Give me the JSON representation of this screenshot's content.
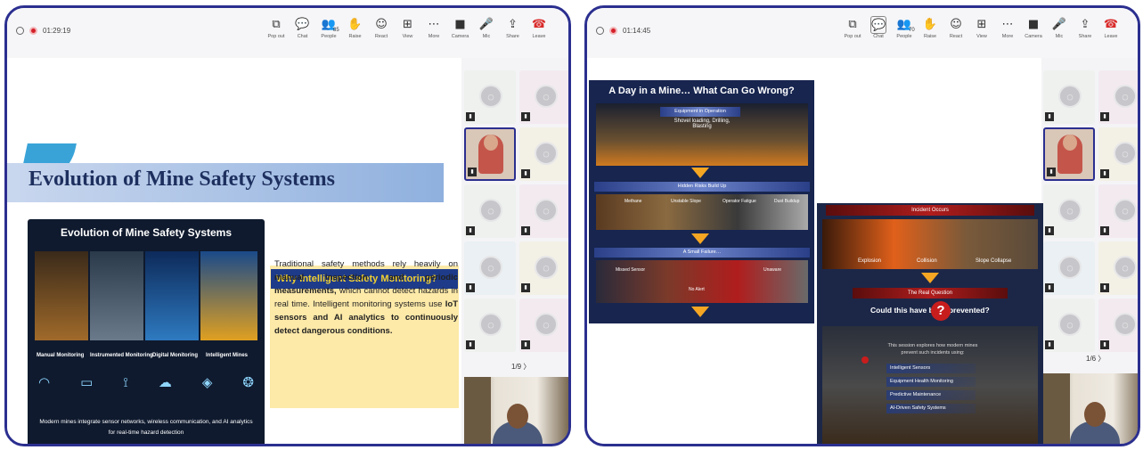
{
  "left": {
    "timer": "01:29:19",
    "toolbar": [
      {
        "icon": "popout-icon",
        "glyph": "⧉",
        "label": "Pop out"
      },
      {
        "icon": "chat-icon",
        "glyph": "💬",
        "label": "Chat"
      },
      {
        "icon": "people-icon",
        "glyph": "👥",
        "label": "People",
        "count": "85"
      },
      {
        "icon": "raise-hand-icon",
        "glyph": "✋",
        "label": "Raise"
      },
      {
        "icon": "react-icon",
        "glyph": "☺",
        "label": "React"
      },
      {
        "icon": "view-icon",
        "glyph": "⊞",
        "label": "View"
      },
      {
        "icon": "more-icon",
        "glyph": "⋯",
        "label": "More"
      },
      {
        "icon": "camera-icon",
        "glyph": "■",
        "label": "Camera"
      },
      {
        "icon": "mic-icon",
        "glyph": "🎤",
        "label": "Mic"
      },
      {
        "icon": "share-icon",
        "glyph": "⇪",
        "label": "Share"
      },
      {
        "icon": "leave-icon",
        "glyph": "☎",
        "label": "Leave"
      }
    ],
    "slide": {
      "title": "Evolution of Mine Safety Systems",
      "card_title": "Evolution of Mine Safety Systems",
      "stages": [
        "Manual Monitoring",
        "Instrumented Monitoring",
        "Digital Monitoring",
        "Intelligent Mines"
      ],
      "card_footer": "Modern mines integrate sensor networks, wireless communication, and AI analytics for real-time hazard detection",
      "panel_title": "Why Intelligent Safety Monitoring?",
      "panel_text_1": "Traditional safety methods rely heavily on",
      "panel_bold_1": "manual inspection and periodic measurements,",
      "panel_text_2": "which cannot detect hazards in real time. Intelligent monitoring systems use",
      "panel_bold_2": "IoT sensors and AI analytics to continuously detect dangerous conditions."
    },
    "pager": "1/9 〉"
  },
  "right": {
    "timer": "01:14:45",
    "toolbar": [
      {
        "icon": "popout-icon",
        "glyph": "⧉",
        "label": "Pop out"
      },
      {
        "icon": "chat-icon",
        "glyph": "💬",
        "label": "Chat"
      },
      {
        "icon": "people-icon",
        "glyph": "👥",
        "label": "People",
        "count": "70"
      },
      {
        "icon": "raise-hand-icon",
        "glyph": "✋",
        "label": "Raise"
      },
      {
        "icon": "react-icon",
        "glyph": "☺",
        "label": "React"
      },
      {
        "icon": "view-icon",
        "glyph": "⊞",
        "label": "View"
      },
      {
        "icon": "more-icon",
        "glyph": "⋯",
        "label": "More"
      },
      {
        "icon": "camera-icon",
        "glyph": "■",
        "label": "Camera"
      },
      {
        "icon": "mic-icon",
        "glyph": "🎤",
        "label": "Mic"
      },
      {
        "icon": "share-icon",
        "glyph": "⇪",
        "label": "Share"
      },
      {
        "icon": "leave-icon",
        "glyph": "☎",
        "label": "Leave"
      }
    ],
    "slide": {
      "title": "A Day in a Mine… What Can Go Wrong?",
      "band_1": "Equipment in Operation",
      "band_1_sub": "Shovel loading, Drilling, Blasting",
      "band_2": "Hidden Risks Build Up",
      "risks": [
        "Methane",
        "Unstable Slope",
        "Operator Fatigue",
        "Dust Buildup"
      ],
      "band_3": "A Small Failure…",
      "failures": [
        "Missed Sensor",
        "No Alert",
        "Unaware"
      ],
      "incident_title": "Incident Occurs",
      "incidents": [
        "Explosion",
        "Collision",
        "Slope Collapse"
      ],
      "real_question_title": "The Real Question",
      "question": "Could this have been prevented?",
      "intro": "This session explores how modern mines prevent such incidents using:",
      "bullets": [
        "Intelligent Sensors",
        "Equipment Health Monitoring",
        "Predictive Maintenance",
        "AI-Driven Safety Systems"
      ]
    },
    "pager": "1/6 〉"
  }
}
